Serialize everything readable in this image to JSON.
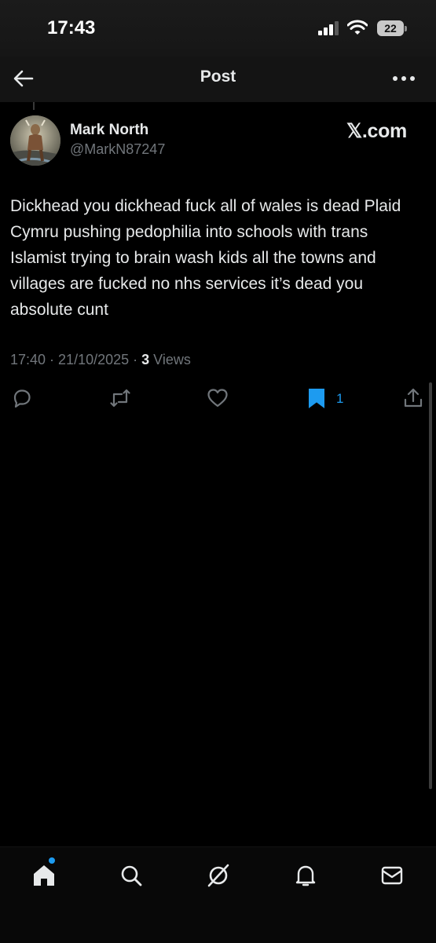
{
  "status_bar": {
    "time": "17:43",
    "battery": "22"
  },
  "header": {
    "title": "Post"
  },
  "post": {
    "author_name": "Mark North",
    "author_handle": "@MarkN87247",
    "source": "𝕏.com",
    "text": "Dickhead you dickhead fuck all of wales is dead Plaid Cymru pushing pedophilia into schools with trans Islamist trying to brain wash kids all the towns and villages are fucked no nhs services it’s dead you absolute cunt",
    "time": "17:40",
    "separator": " · ",
    "date": "21/10/2025",
    "views_count": "3",
    "views_label": "Views",
    "bookmark_count": "1"
  },
  "icons": {
    "back": "back-arrow-icon",
    "more": "more-dots-icon",
    "reply": "reply-icon",
    "repost": "repost-icon",
    "like": "like-icon",
    "bookmark": "bookmark-icon",
    "share": "share-icon",
    "nav": [
      "home-icon",
      "search-icon",
      "grok-icon",
      "notifications-icon",
      "messages-icon"
    ]
  },
  "colors": {
    "accent": "#1d9bf0",
    "text": "#e7e9ea",
    "muted": "#71767b",
    "background": "#000000"
  }
}
